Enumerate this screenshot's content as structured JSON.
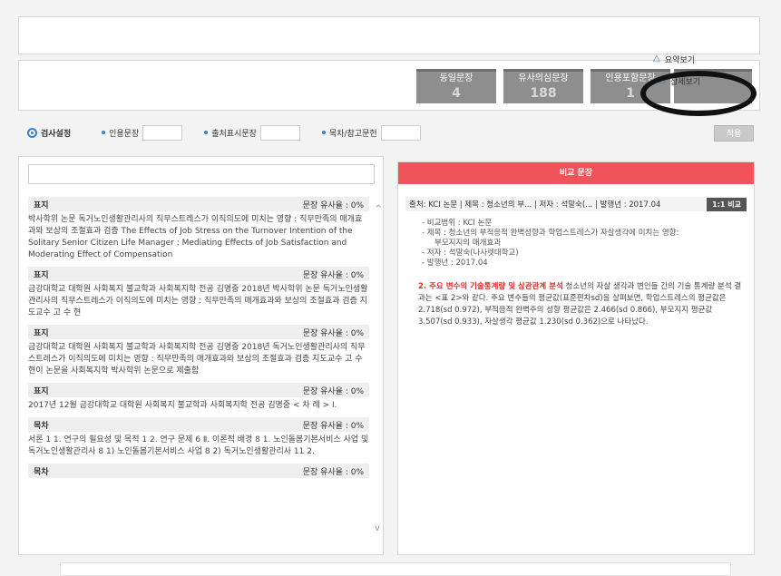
{
  "stats": [
    {
      "label": "동일문장",
      "value": "4"
    },
    {
      "label": "유사의심문장",
      "value": "188"
    },
    {
      "label": "인용포함문장",
      "value": "1"
    },
    {
      "label": "",
      "value": ""
    }
  ],
  "view_menu": {
    "summary": "요약보기",
    "detail": "상세보기"
  },
  "settings": {
    "title": "검사설정",
    "options": [
      "인용문장",
      "출처표시문장",
      "목차/참고문헌"
    ],
    "apply": "적용"
  },
  "left_items": [
    {
      "type": "표지",
      "sim": "문장 유사율 : 0%",
      "text": "박사학위 논문 독거노인생활관리사의 직무스트레스가 이직의도에 미치는 영향 : 직무만족의 매개효과와 보상의 조절효과 검증 The Effects of Job Stress on the Turnover Intention of the Solitary Senior Citizen Life Manager : Mediating Effects of Job Satisfaction and Moderating Effect of Compensation"
    },
    {
      "type": "표지",
      "sim": "문장 유사율 : 0%",
      "text": "금강대학교 대학원 사회복지 불교학과 사회복지학 전공 김명중 2018년 박사학위 논문 독거노인생활관리사의 직무스트레스가 이직의도에 미치는 영향 : 직무만족의 매개효과와 보상의 조절효과 검증 지도교수 고 수 현"
    },
    {
      "type": "표지",
      "sim": "문장 유사율 : 0%",
      "text": "금강대학교 대학원 사회복지 불교학과 사회복지학 전공 김명중 2018년 독거노인생활관리사의 직무스트레스가 이직의도에 미치는 영향 : 직무만족의 매개효과와 보상의 조절효과 검증 지도교수 고 수현이 논문을 사회복지학 박사학위 논문으로 제출함"
    },
    {
      "type": "표지",
      "sim": "문장 유사율 : 0%",
      "text": "2017년 12월 금강대학교 대학원 사회복지 불교학과 사회복지학 전공 김명중 < 차 례 > Ⅰ."
    },
    {
      "type": "목차",
      "sim": "문장 유사율 : 0%",
      "text": "서론 1 1. 연구의 필요성 및 목적 1 2. 연구 문제 6 Ⅱ. 이론적 배경 8 1. 노인돌봄기본서비스 사업 및 독거노인생활관리사 8 1) 노인돌봄기본서비스 사업 8 2) 독거노인생활관리사 11 2."
    },
    {
      "type": "목차",
      "sim": "문장 유사율 : 0%",
      "text": ""
    }
  ],
  "right": {
    "header": "비교 문장",
    "source": "출처: KCI 논문 | 제목 : 청소년의 부... | 저자 : 석말숙(... | 발행년 : 2017.04",
    "compare_btn": "1:1 비교",
    "meta": {
      "range": "- 비교범위 : KCI 논문",
      "title": "- 제목 : 청소년의 부적응적 완벽성향과 학업스트레스가 자살생각에 미치는 영향:",
      "title2": "부모지지의 매개효과",
      "author": "- 저자 : 석말숙(나사렛대학교)",
      "year": "- 발행년 : 2017.04"
    },
    "para_num": "2. ",
    "para_highlight": "주요 변수의 기술통계량 및 상관관계 분석",
    "para_rest": " 청소년의 자살 생각과 변인들 간의 기술 통계량 분석 결과는 <표 2>와 같다. 주요 변수들의 평균값(표준편차sd)을 살펴보면, 학업스트레스의 평균값은 2.718(sd 0.972), 부적응적 완벽주의 성향 평균값은 2.466(sd 0.866), 부모지지 평균값 3.507(sd 0.933), 자살생각 평균값 1.230(sd 0.362)으로 나타났다."
  }
}
